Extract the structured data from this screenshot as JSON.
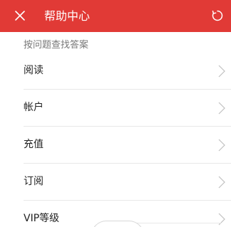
{
  "header": {
    "title": "帮助中心",
    "close_icon": "close-icon",
    "refresh_icon": "refresh-icon",
    "background_color": "#e13a36"
  },
  "section": {
    "label": "按问题查找答案"
  },
  "items": [
    {
      "label": "阅读"
    },
    {
      "label": "帐户"
    },
    {
      "label": "充值"
    },
    {
      "label": "订阅"
    },
    {
      "label": "VIP等级"
    }
  ]
}
